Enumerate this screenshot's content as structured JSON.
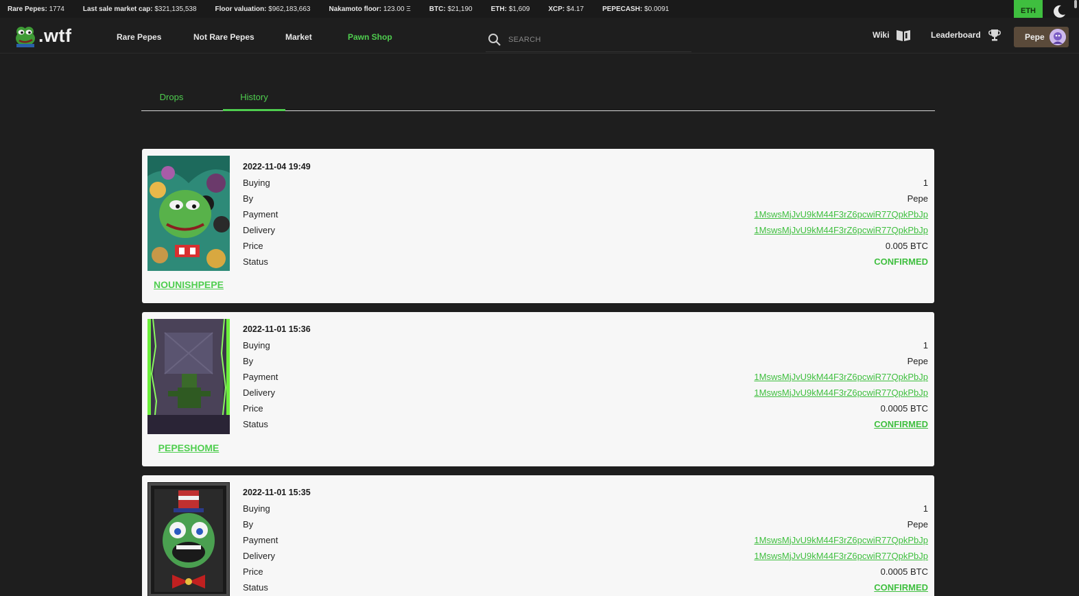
{
  "ticker": {
    "rare_pepes_label": "Rare Pepes:",
    "rare_pepes_value": "1774",
    "market_cap_label": "Last sale market cap:",
    "market_cap_value": "$321,135,538",
    "floor_label": "Floor valuation:",
    "floor_value": "$962,183,663",
    "nakamoto_label": "Nakamoto floor:",
    "nakamoto_value": "123.00 Ξ",
    "btc_label": "BTC:",
    "btc_value": "$21,190",
    "eth_label": "ETH:",
    "eth_value": "$1,609",
    "xcp_label": "XCP:",
    "xcp_value": "$4.17",
    "pepecash_label": "PEPECASH:",
    "pepecash_value": "$0.0091"
  },
  "currency_toggle": "ETH",
  "logo_text": ".wtf",
  "nav": {
    "rare_pepes": "Rare Pepes",
    "not_rare_pepes": "Not Rare Pepes",
    "market": "Market",
    "pawn_shop": "Pawn Shop"
  },
  "search": {
    "placeholder": "SEARCH"
  },
  "wiki_label": "Wiki",
  "leaderboard_label": "Leaderboard",
  "user_label": "Pepe",
  "tabs": {
    "drops": "Drops",
    "history": "History"
  },
  "row_labels": {
    "buying": "Buying",
    "by": "By",
    "payment": "Payment",
    "delivery": "Delivery",
    "price": "Price",
    "status": "Status"
  },
  "orders": [
    {
      "date": "2022-11-04 19:49",
      "name": "NOUNISHPEPE",
      "buying": "1",
      "by": "Pepe",
      "payment": "1MswsMjJvU9kM44F3rZ6pcwiR77QpkPbJp",
      "delivery": "1MswsMjJvU9kM44F3rZ6pcwiR77QpkPbJp",
      "price": "0.005 BTC",
      "status": "CONFIRMED"
    },
    {
      "date": "2022-11-01 15:36",
      "name": "PEPESHOME",
      "buying": "1",
      "by": "Pepe",
      "payment": "1MswsMjJvU9kM44F3rZ6pcwiR77QpkPbJp",
      "delivery": "1MswsMjJvU9kM44F3rZ6pcwiR77QpkPbJp",
      "price": "0.0005 BTC",
      "status": "CONFIRMED"
    },
    {
      "date": "2022-11-01 15:35",
      "buying": "1",
      "by": "Pepe",
      "payment": "1MswsMjJvU9kM44F3rZ6pcwiR77QpkPbJp",
      "delivery": "1MswsMjJvU9kM44F3rZ6pcwiR77QpkPbJp",
      "price": "0.0005 BTC",
      "status": "CONFIRMED"
    }
  ],
  "colors": {
    "accent": "#4fce4f",
    "background": "#1e1e1e",
    "card": "#f7f7f7"
  }
}
